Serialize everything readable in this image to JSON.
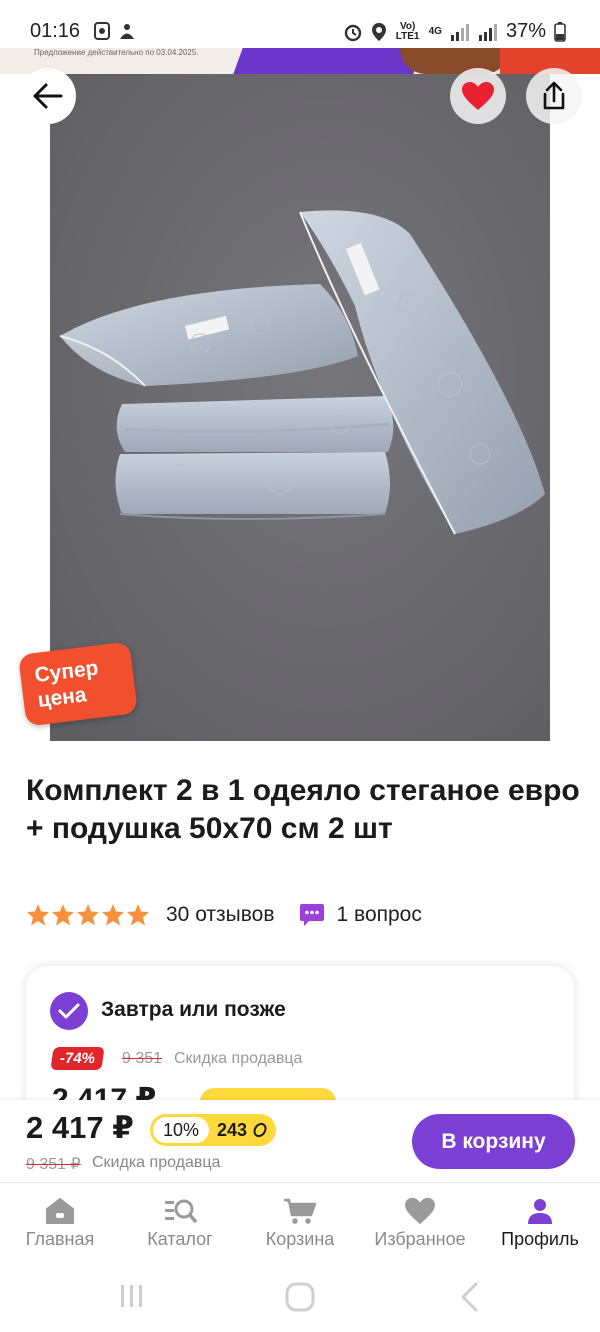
{
  "status_bar": {
    "time": "01:16",
    "network": "Vo) LTE1",
    "net_type": "4G",
    "battery": "37%"
  },
  "promo": {
    "text": "Предложение действительно по 03.04.2025."
  },
  "product": {
    "super_badge": "Супер цена",
    "title": "Комплект 2 в 1 одеяло стеганое евро + подушка 50х70 см 2 шт",
    "rating": 5,
    "reviews": "30 отзывов",
    "questions": "1 вопрос"
  },
  "delivery": {
    "title": "Завтра или позже",
    "discount": "-74%",
    "old_price": "9 351",
    "seller_discount": "Скидка продавца",
    "price": "2 417 ₽"
  },
  "buy_bar": {
    "price": "2 417 ₽",
    "bonus_percent": "10%",
    "bonus_amount": "243",
    "old_price": "9 351 ₽",
    "seller_discount": "Скидка продавца",
    "cart_button": "В корзину"
  },
  "nav": {
    "items": [
      {
        "label": "Главная",
        "icon": "home-icon"
      },
      {
        "label": "Каталог",
        "icon": "catalog-search-icon"
      },
      {
        "label": "Корзина",
        "icon": "cart-icon"
      },
      {
        "label": "Избранное",
        "icon": "heart-icon"
      },
      {
        "label": "Профиль",
        "icon": "profile-icon"
      }
    ],
    "active": "Профиль"
  },
  "colors": {
    "accent": "#7b3fd3",
    "discount": "#e0262a",
    "bonus": "#ffd93c",
    "star": "#f7913d",
    "badge": "#f24f2f"
  }
}
